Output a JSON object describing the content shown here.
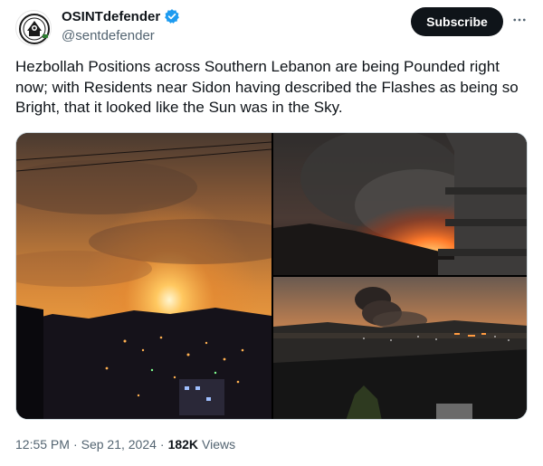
{
  "author": {
    "display_name": "OSINTdefender",
    "handle": "@sentdefender",
    "avatar_icon": "osint-logo-icon",
    "verified_icon": "verified-badge-icon",
    "verified_color": "#1d9bf0"
  },
  "actions": {
    "subscribe_label": "Subscribe",
    "more_icon": "more-horizontal-icon"
  },
  "tweet": {
    "text": "Hezbollah Positions across Southern Lebanon are being Pounded right now; with Residents near Sidon having described the Flashes as being so Bright, that it looked like the Sun was in the Sky."
  },
  "media": {
    "photo_count": 3
  },
  "meta": {
    "time": "12:55 PM",
    "separator": "·",
    "date": "Sep 21, 2024",
    "views_count": "182K",
    "views_label": "Views"
  },
  "colors": {
    "text": "#0f1419",
    "secondary": "#536471",
    "button_bg": "#0f1419",
    "border": "#cfd9de"
  }
}
